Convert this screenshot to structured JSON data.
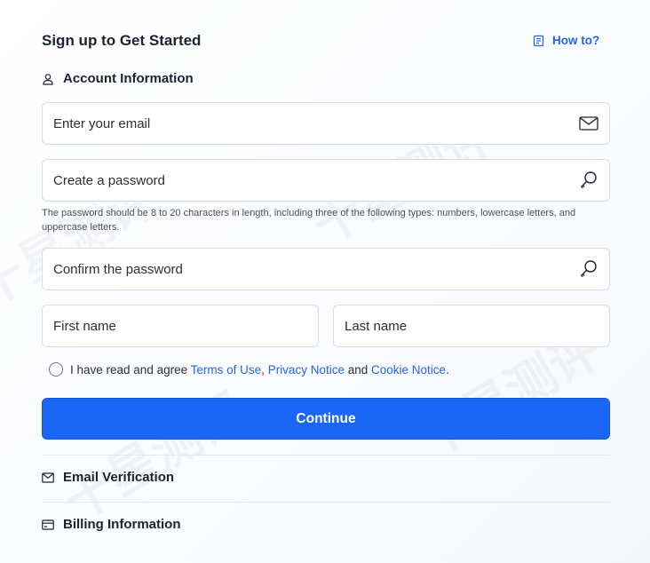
{
  "header": {
    "title": "Sign up to Get Started",
    "howto_label": "How to?"
  },
  "account": {
    "section_title": "Account Information",
    "email_placeholder": "Enter your email",
    "password_placeholder": "Create a password",
    "password_hint": "The password should be 8 to 20 characters in length, including three of the following types: numbers, lowercase letters, and uppercase letters.",
    "confirm_placeholder": "Confirm the password",
    "first_name_placeholder": "First name",
    "last_name_placeholder": "Last name"
  },
  "agreement": {
    "prefix": "I have read and agree",
    "terms": "Terms of Use",
    "comma": ",",
    "privacy": "Privacy Notice",
    "and": "and",
    "cookie": "Cookie Notice",
    "period": "."
  },
  "continue_label": "Continue",
  "sections": {
    "email_verification": "Email Verification",
    "billing_information": "Billing Information"
  },
  "watermark_text": "十星测评",
  "icons": {
    "howto": "document-icon",
    "account": "user-icon",
    "email_field": "envelope-icon",
    "password_field": "key-search-icon",
    "email_section": "envelope-icon",
    "billing_section": "card-icon"
  },
  "colors": {
    "accent": "#1a66f5",
    "link": "#2563e8",
    "text": "#1b2233"
  }
}
